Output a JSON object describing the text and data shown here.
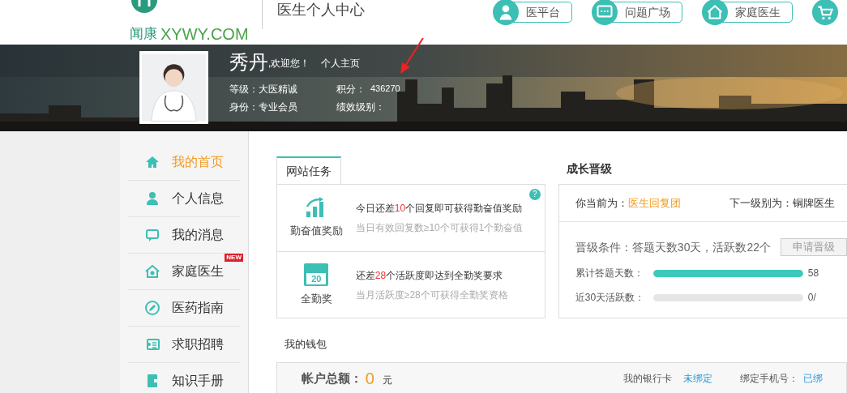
{
  "header": {
    "logo_text": "闻康",
    "logo_domain": "XYWY.COM",
    "title": "医生个人中心",
    "nav": [
      {
        "label": "医平台",
        "kind": "doctor"
      },
      {
        "label": "问题广场",
        "kind": "chat"
      },
      {
        "label": "家庭医生",
        "kind": "home"
      },
      {
        "kind": "cart"
      }
    ]
  },
  "profile": {
    "name": "秀丹",
    "welcome": ",欢迎您！",
    "homepage_link": "个人主页",
    "level_label": "等级：",
    "level": "大医精诚",
    "points_label": "积分：",
    "points": "436270",
    "identity_label": "身份：",
    "identity": "专业会员",
    "performance_label": "绩效级别："
  },
  "sidebar": {
    "items": [
      {
        "label": "我的首页",
        "kind": "home",
        "selected": true
      },
      {
        "label": "个人信息",
        "kind": "user",
        "selected": false
      },
      {
        "label": "我的消息",
        "kind": "message",
        "selected": false
      },
      {
        "label": "家庭医生",
        "kind": "house",
        "selected": false,
        "badge": "NEW"
      },
      {
        "label": "医药指南",
        "kind": "pen",
        "selected": false
      },
      {
        "label": "求职招聘",
        "kind": "card",
        "selected": false
      },
      {
        "label": "知识手册",
        "kind": "book",
        "selected": false
      }
    ]
  },
  "tasks": {
    "tab": "网站任务",
    "help": "?",
    "items": [
      {
        "kind": "chart",
        "label": "勤奋值奖励",
        "title_before": "今日还差",
        "count": "10",
        "title_after": "个回复即可获得勤奋值奖励",
        "note": "当日有效回复数≥10个可获得1个勤奋值"
      },
      {
        "kind": "calendar",
        "calendar_day": "20",
        "label": "全勤奖",
        "title_before": "还差",
        "count": "28",
        "title_after": "个活跃度即达到全勤奖要求",
        "note": "当月活跃度≥28个可获得全勤奖资格"
      }
    ]
  },
  "growth": {
    "title": "成长晋级",
    "current_label": "你当前为：",
    "current": "医生回复团",
    "next_label": "下一级别为：",
    "next": "铜牌医生",
    "conditions": "晋级条件：答题天数30天，活跃数22个",
    "apply_button": "申请晋级",
    "meters": [
      {
        "label": "累计答题天数：",
        "level": 1,
        "reading": "58"
      },
      {
        "label": "近30天活跃数：",
        "level": 0,
        "reading": "0/"
      }
    ]
  },
  "wallet": {
    "title": "我的钱包",
    "balance_label": "帐户总额：",
    "balance": "0",
    "unit": "元",
    "bank_label": "我的银行卡",
    "bank_status": "未绑定",
    "phone_label": "绑定手机号：",
    "phone_status": "已绑"
  }
}
